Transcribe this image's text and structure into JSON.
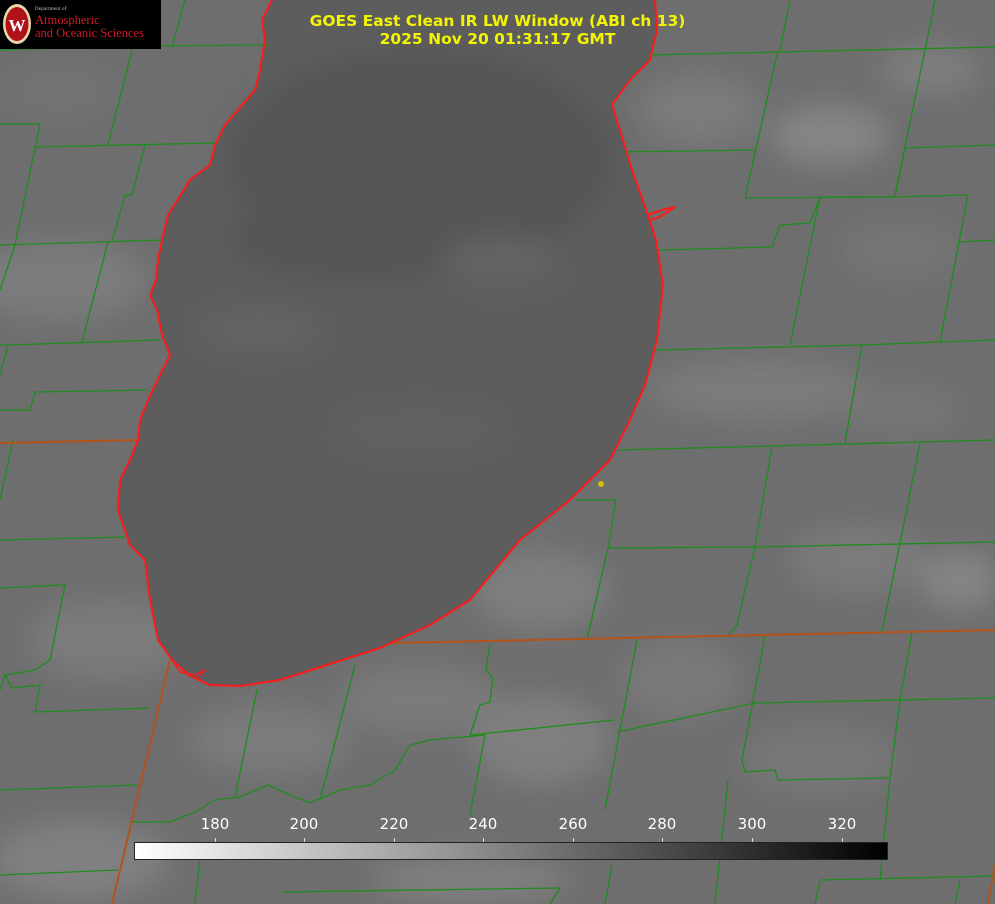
{
  "header": {
    "title_line1": "GOES East Clean IR LW Window (ABI ch 13)",
    "title_line2": "2025 Nov 20 01:31:17 GMT"
  },
  "logo": {
    "department": "Department of",
    "line1": "Atmospheric",
    "line2": "and Oceanic Sciences",
    "seal_letter": "W"
  },
  "colorbar": {
    "ticks": [
      "180",
      "200",
      "220",
      "240",
      "260",
      "280",
      "300",
      "320"
    ],
    "gradient_from": "#ffffff",
    "gradient_to": "#000000"
  },
  "colors": {
    "title": "#f4f500",
    "lake_shoreline": "#ff1a1a",
    "county_lines": "#1e8c1e",
    "state_line": "#b5521a",
    "station_dot": "#cfc000",
    "lake_fill": "#5b5b5b",
    "land_fill": "#6e6e6e"
  }
}
